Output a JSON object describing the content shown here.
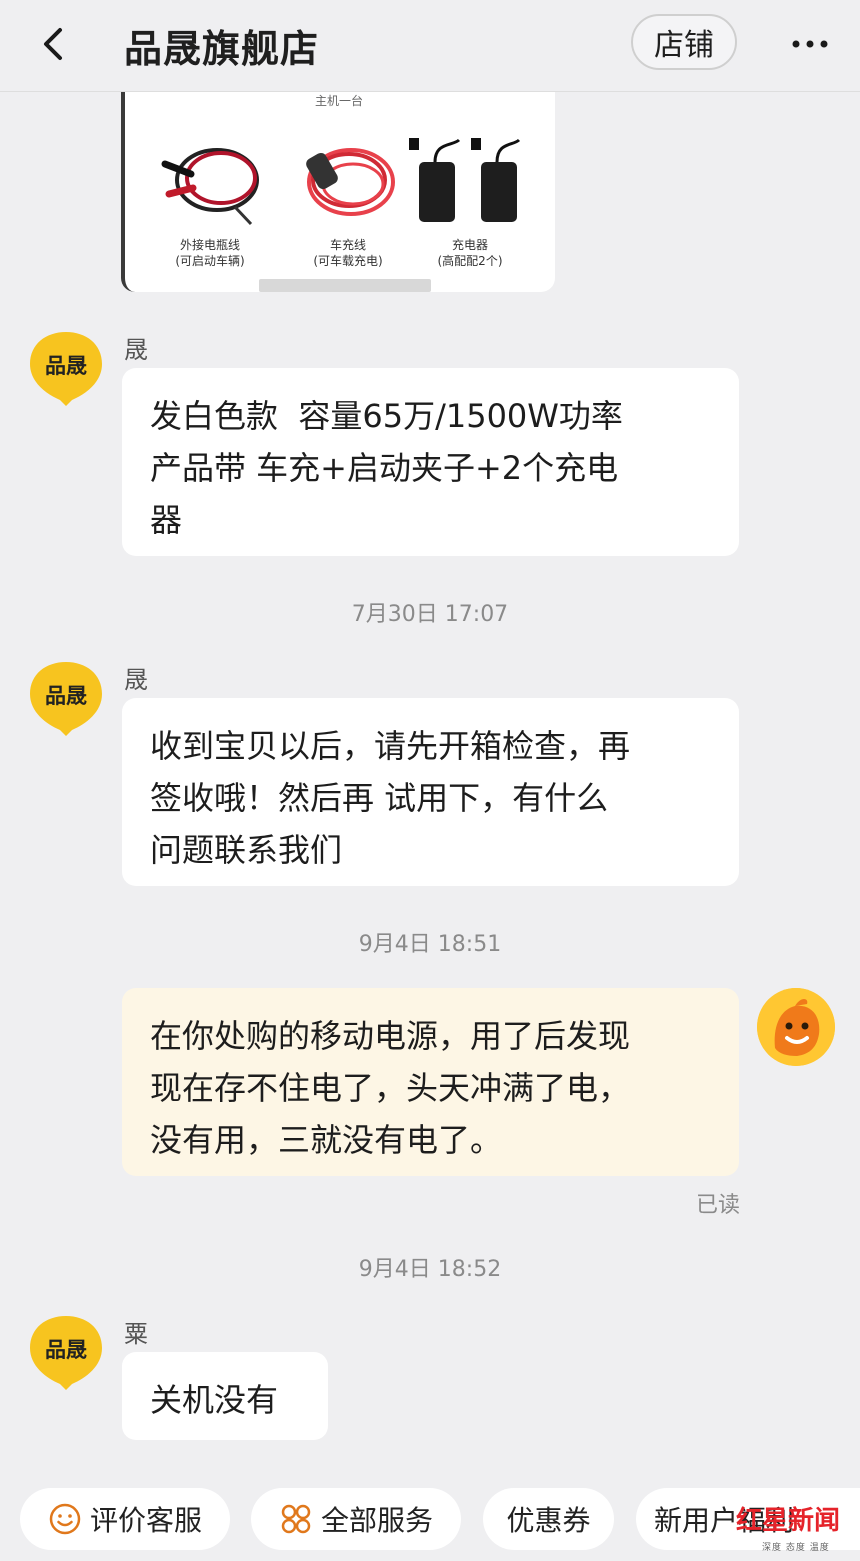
{
  "header": {
    "title": "品晟旗舰店",
    "shop_button": "店铺"
  },
  "product_image": {
    "caption_top": "主机一台",
    "items": [
      {
        "label": "外接电瓶线",
        "sub": "(可启动车辆)"
      },
      {
        "label": "车充线",
        "sub": "(可车载充电)"
      },
      {
        "label": "充电器",
        "sub": "(高配配2个)"
      }
    ]
  },
  "messages": [
    {
      "avatar_text": "品晟",
      "sender": "晟",
      "text": "发白色款  容量65万/1500W功率\n产品带 车充+启动夹子+2个充电\n器"
    },
    {
      "time": "7月30日 17:07"
    },
    {
      "avatar_text": "品晟",
      "sender": "晟",
      "text": "收到宝贝以后，请先开箱检查，再\n签收哦！然后再 试用下，有什么\n问题联系我们"
    },
    {
      "time": "9月4日 18:51"
    },
    {
      "text": "在你处购的移动电源，用了后发现\n现在存不住电了，头天冲满了电，\n没有用，三就没有电了。",
      "status": "已读"
    },
    {
      "time": "9月4日 18:52"
    },
    {
      "avatar_text": "品晟",
      "sender": "粟",
      "text": "关机没有"
    }
  ],
  "bottom_bar": {
    "items": [
      {
        "label": "评价客服",
        "icon": "smile-icon"
      },
      {
        "label": "全部服务",
        "icon": "grid-icon"
      },
      {
        "label": "优惠券"
      },
      {
        "label": "新用户福利"
      }
    ]
  },
  "watermark": {
    "brand": "红星新闻",
    "tagline": "深度 态度 温度"
  },
  "colors": {
    "avatar_yellow": "#f7c41f",
    "bubble_me": "#fdf6e5",
    "bg": "#efeff1",
    "watermark_red": "#e5232a"
  }
}
